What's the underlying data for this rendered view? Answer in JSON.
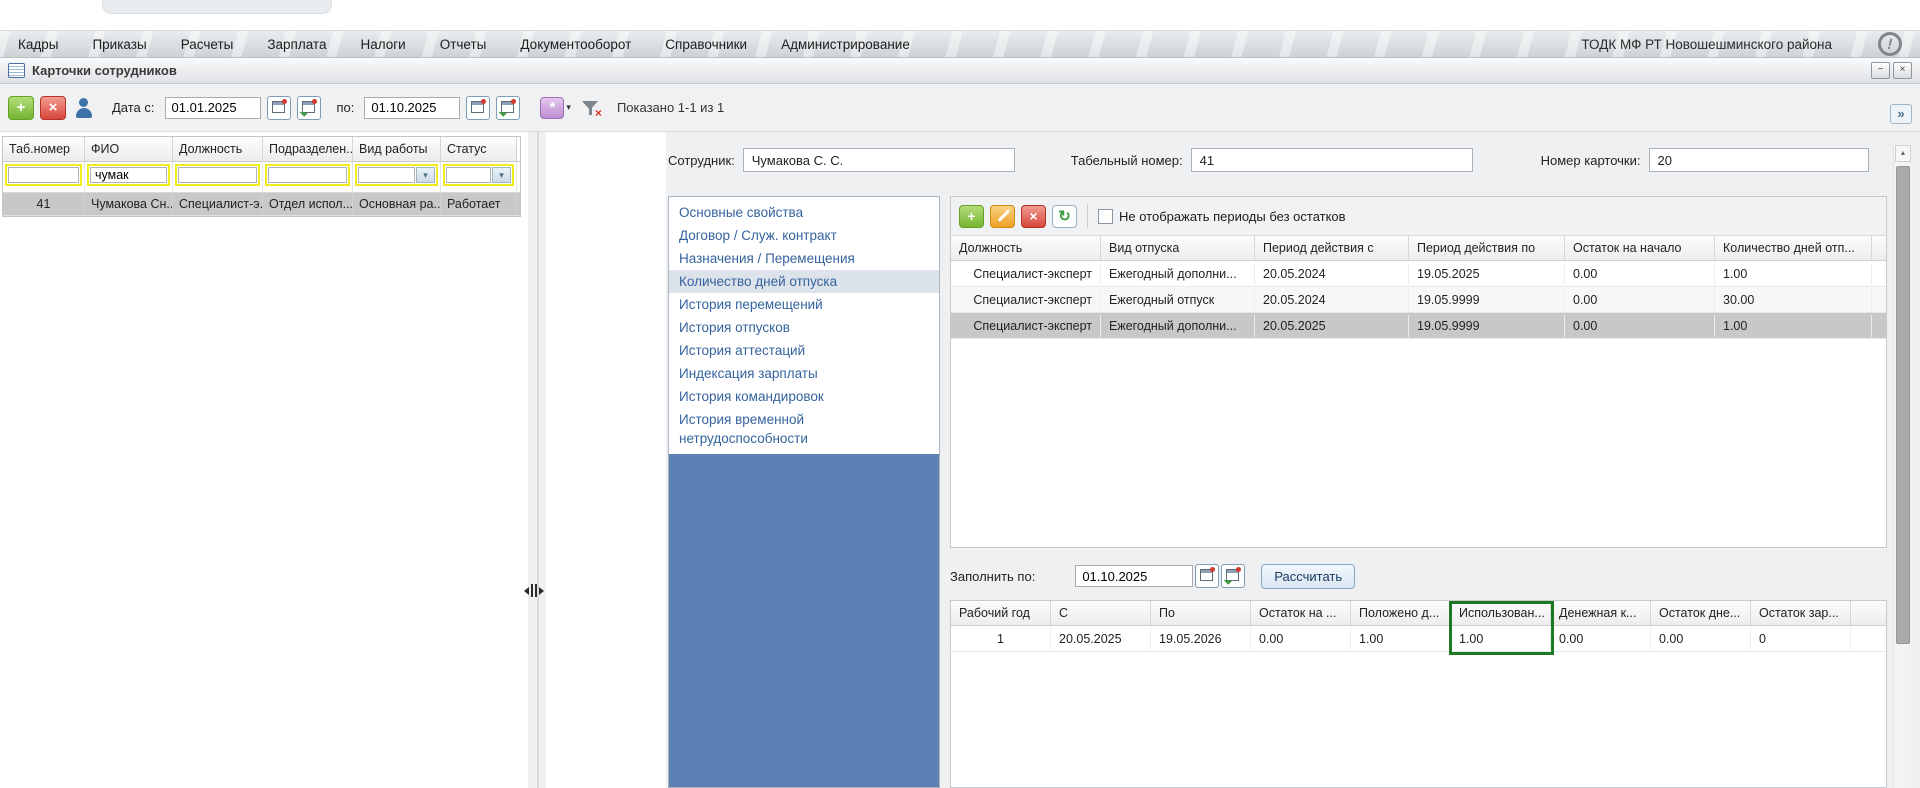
{
  "menubar": {
    "items": [
      "Кадры",
      "Приказы",
      "Расчеты",
      "Зарплата",
      "Налоги",
      "Отчеты",
      "Документооборот",
      "Справочники",
      "Администрирование"
    ],
    "org": "ТОДК МФ РТ Новошешминского района"
  },
  "window": {
    "title": "Карточки сотрудников"
  },
  "icons": {
    "minimize": "−",
    "close": "×",
    "collapse": "»",
    "dropdown": "▾",
    "scroll_up": "▲",
    "alert": "!",
    "add": "+",
    "delete": "×",
    "refresh": "↻"
  },
  "toolbar": {
    "date_from_label": "Дата с:",
    "date_from": "01.01.2025",
    "date_to_label": "по:",
    "date_to": "01.10.2025",
    "shown": "Показано 1-1 из 1"
  },
  "employee_grid": {
    "columns": [
      "Таб.номер",
      "ФИО",
      "Должность",
      "Подразделен...",
      "Вид работы",
      "Статус"
    ],
    "filters": [
      "",
      "чумак",
      "",
      "",
      "",
      ""
    ],
    "rows": [
      [
        "41",
        "Чумакова Сн...",
        "Специалист-э...",
        "Отдел испол...",
        "Основная ра...",
        "Работает"
      ]
    ],
    "selected_row_index": 0
  },
  "detail": {
    "employee_label": "Сотрудник:",
    "employee": "Чумакова С. С.",
    "tab_number_label": "Табельный номер:",
    "tab_number": "41",
    "card_number_label": "Номер карточки:",
    "card_number": "20",
    "nav": {
      "items": [
        "Основные свойства",
        "Договор / Служ. контракт",
        "Назначения / Перемещения",
        "Количество дней отпуска",
        "История перемещений",
        "История отпусков",
        "История аттестаций",
        "Индексация зарплаты",
        "История командировок",
        "История временной нетрудоспособности"
      ],
      "selected_index": 3
    }
  },
  "vacation_periods": {
    "hide_empty_label": "Не отображать периоды без остатков",
    "columns": [
      "Должность",
      "Вид отпуска",
      "Период действия с",
      "Период действия по",
      "Остаток на начало",
      "Количество дней отп..."
    ],
    "rows": [
      [
        "Специалист-эксперт",
        "Ежегодный дополни...",
        "20.05.2024",
        "19.05.2025",
        "0.00",
        "1.00"
      ],
      [
        "Специалист-эксперт",
        "Ежегодный отпуск",
        "20.05.2024",
        "19.05.9999",
        "0.00",
        "30.00"
      ],
      [
        "Специалист-эксперт",
        "Ежегодный дополни...",
        "20.05.2025",
        "19.05.9999",
        "0.00",
        "1.00"
      ]
    ],
    "selected_row_index": 2
  },
  "fill": {
    "label": "Заполнить по:",
    "date": "01.10.2025",
    "calculate_label": "Рассчитать"
  },
  "work_years": {
    "columns": [
      "Рабочий год",
      "С",
      "По",
      "Остаток на ...",
      "Положено д...",
      "Использован...",
      "Денежная к...",
      "Остаток дне...",
      "Остаток зар..."
    ],
    "rows": [
      [
        "1",
        "20.05.2025",
        "19.05.2026",
        "0.00",
        "1.00",
        "1.00",
        "0.00",
        "0.00",
        "0"
      ]
    ],
    "highlight_column_index": 5
  },
  "colors": {
    "accent_blue": "#5c80b4",
    "link_blue": "#35639e",
    "filter_yellow": "#f1ea1c",
    "highlight_green": "#1d7a24",
    "selected_row_gray": "#c6c8ca"
  }
}
